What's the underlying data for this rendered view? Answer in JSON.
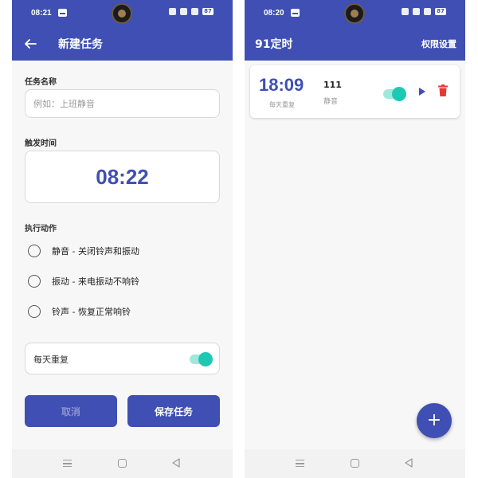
{
  "left": {
    "status": {
      "time": "08:21",
      "battery": "87"
    },
    "topbar": {
      "title": "新建任务"
    },
    "task_name": {
      "label": "任务名称",
      "placeholder": "例如：上班静音"
    },
    "trigger_time": {
      "label": "触发时间",
      "value": "08:22"
    },
    "action": {
      "label": "执行动作",
      "options": [
        {
          "label": "静音 - 关闭铃声和振动"
        },
        {
          "label": "振动 - 来电振动不响铃"
        },
        {
          "label": "铃声 - 恢复正常响铃"
        }
      ]
    },
    "repeat": {
      "label": "每天重复",
      "enabled": true
    },
    "buttons": {
      "cancel": "取消",
      "save": "保存任务"
    }
  },
  "right": {
    "status": {
      "time": "08:20",
      "battery": "87"
    },
    "topbar": {
      "title": "91定时",
      "action": "权限设置"
    },
    "tasks": [
      {
        "time": "18:09",
        "repeat": "每天重复",
        "name": "111",
        "action": "静音",
        "enabled": true
      }
    ],
    "fab_label": "+"
  },
  "colors": {
    "primary": "#3f4fb3",
    "toggle_on": "#1ec9b3",
    "delete": "#e53935"
  },
  "icons": [
    "back-arrow-icon",
    "play-icon",
    "trash-icon",
    "plus-icon",
    "nav-menu-icon",
    "nav-home-icon",
    "nav-back-icon"
  ]
}
